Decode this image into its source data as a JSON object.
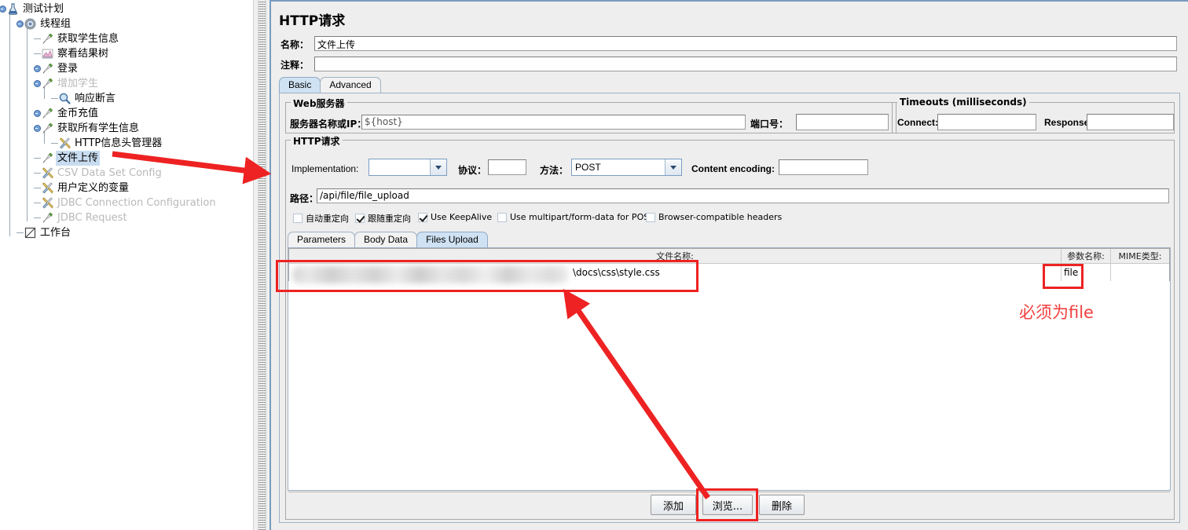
{
  "tree": {
    "items": [
      {
        "label": "测试计划",
        "icon": "test-plan-icon",
        "depth": 0,
        "dim": false,
        "selected": false,
        "expander": true
      },
      {
        "label": "线程组",
        "icon": "thread-group-icon",
        "depth": 1,
        "dim": false,
        "selected": false,
        "expander": true
      },
      {
        "label": "获取学生信息",
        "icon": "http-sampler-icon",
        "depth": 2,
        "dim": false,
        "selected": false,
        "expander": false
      },
      {
        "label": "察看结果树",
        "icon": "view-results-tree-icon",
        "depth": 2,
        "dim": false,
        "selected": false,
        "expander": false
      },
      {
        "label": "登录",
        "icon": "http-sampler-icon",
        "depth": 2,
        "dim": false,
        "selected": false,
        "expander": true
      },
      {
        "label": "增加学生",
        "icon": "http-sampler-icon",
        "depth": 2,
        "dim": true,
        "selected": false,
        "expander": true
      },
      {
        "label": "响应断言",
        "icon": "assertion-icon",
        "depth": 3,
        "dim": false,
        "selected": false,
        "expander": false
      },
      {
        "label": "金币充值",
        "icon": "http-sampler-icon",
        "depth": 2,
        "dim": false,
        "selected": false,
        "expander": true
      },
      {
        "label": "获取所有学生信息",
        "icon": "http-sampler-icon",
        "depth": 2,
        "dim": false,
        "selected": false,
        "expander": true
      },
      {
        "label": "HTTP信息头管理器",
        "icon": "header-manager-icon",
        "depth": 3,
        "dim": false,
        "selected": false,
        "expander": false
      },
      {
        "label": "文件上传",
        "icon": "http-sampler-icon",
        "depth": 2,
        "dim": false,
        "selected": true,
        "expander": false
      },
      {
        "label": "CSV Data Set Config",
        "icon": "config-icon",
        "depth": 2,
        "dim": true,
        "selected": false,
        "expander": false
      },
      {
        "label": "用户定义的变量",
        "icon": "config-icon",
        "depth": 2,
        "dim": false,
        "selected": false,
        "expander": false
      },
      {
        "label": "JDBC Connection Configuration",
        "icon": "config-icon",
        "depth": 2,
        "dim": true,
        "selected": false,
        "expander": false
      },
      {
        "label": "JDBC Request",
        "icon": "http-sampler-icon",
        "depth": 2,
        "dim": true,
        "selected": false,
        "expander": false
      },
      {
        "label": "工作台",
        "icon": "workbench-icon",
        "depth": 1,
        "dim": false,
        "selected": false,
        "expander": false
      }
    ]
  },
  "main": {
    "title": "HTTP请求",
    "name_label": "名称：",
    "name_value": "文件上传",
    "comment_label": "注释：",
    "comment_value": "",
    "top_tabs": [
      {
        "label": "Basic",
        "active": true
      },
      {
        "label": "Advanced",
        "active": false
      }
    ],
    "web_server": {
      "group_title": "Web服务器",
      "server_label": "服务器名称或IP：",
      "server_value": "${host}",
      "port_label": "端口号：",
      "port_value": ""
    },
    "timeouts": {
      "group_title": "Timeouts (milliseconds)",
      "connect_label": "Connect:",
      "connect_value": "",
      "response_label": "Response:",
      "response_value": ""
    },
    "http_request": {
      "group_title": "HTTP请求",
      "implementation_label": "Implementation:",
      "implementation_value": "",
      "protocol_label": "协议：",
      "protocol_value": "",
      "method_label": "方法：",
      "method_value": "POST",
      "content_encoding_label": "Content encoding:",
      "content_encoding_value": "",
      "path_label": "路径：",
      "path_value": "/api/file/file_upload",
      "checkboxes": [
        {
          "label": "自动重定向",
          "checked": false
        },
        {
          "label": "跟随重定向",
          "checked": true
        },
        {
          "label": "Use KeepAlive",
          "checked": true
        },
        {
          "label": "Use multipart/form-data for POST",
          "checked": false
        },
        {
          "label": "Browser-compatible headers",
          "checked": false
        }
      ],
      "inner_tabs": [
        {
          "label": "Parameters",
          "active": false
        },
        {
          "label": "Body Data",
          "active": false
        },
        {
          "label": "Files Upload",
          "active": true
        }
      ],
      "table": {
        "columns": [
          "文件名称:",
          "参数名称:",
          "MIME类型:"
        ],
        "rows": [
          {
            "file_name": "\\docs\\css\\style.css",
            "file_name_redacted_prefix": true,
            "param_name": "file",
            "mime_type": ""
          }
        ]
      },
      "buttons": [
        {
          "label": "添加",
          "name": "add-button"
        },
        {
          "label": "浏览...",
          "name": "browse-button"
        },
        {
          "label": "删除",
          "name": "delete-button"
        }
      ]
    }
  },
  "annotations": {
    "note_text": "必须为file",
    "accent_color": "#ee2222",
    "note_color": "#f1413f"
  }
}
